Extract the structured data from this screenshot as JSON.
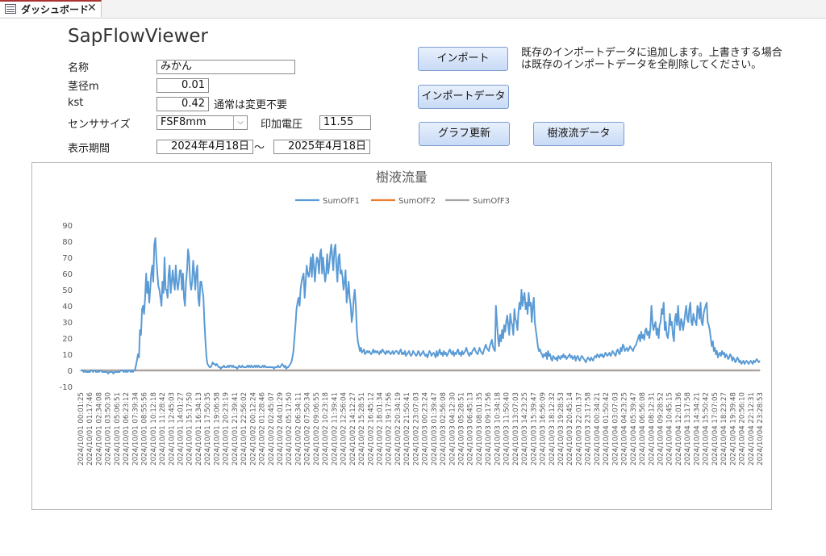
{
  "tab": {
    "label": "ダッシュボード",
    "close": "✕",
    "icon": "form-icon"
  },
  "app_title": "SapFlowViewer",
  "form": {
    "name_label": "名称",
    "name_value": "みかん",
    "stem_label": "茎径m",
    "stem_value": "0.01",
    "kst_label": "kst",
    "kst_value": "0.42",
    "kst_note": "通常は変更不要",
    "sensor_label": "センササイズ",
    "sensor_value": "FSF8mm",
    "sensor_arrow": "⌵",
    "voltage_label": "印加電圧",
    "voltage_value": "11.55",
    "period_label": "表示期間",
    "period_from": "2024年4月18日",
    "period_sep": "〜",
    "period_to": "2025年4月18日"
  },
  "buttons": {
    "import": "インポート",
    "import_data": "インポートデータ",
    "graph_update": "グラフ更新",
    "sapflow_data": "樹液流データ"
  },
  "import_note": "既存のインポートデータに追加します。上書きする場合は既存のインポートデータを全削除してください。",
  "colors": {
    "series1": "#5b9bd5",
    "series2": "#ed7d31",
    "series3": "#a5a5a5",
    "button_border": "#7e9ccf"
  },
  "chart_data": {
    "type": "line",
    "title": "樹液流量",
    "legend": [
      "SumOfF1",
      "SumOfF2",
      "SumOfF3"
    ],
    "legend_position": "top",
    "ylim": [
      -10,
      90
    ],
    "yticks": [
      -10,
      0,
      10,
      20,
      30,
      40,
      50,
      60,
      70,
      80,
      90
    ],
    "grid": false,
    "x_ticks": [
      "2024/10/01 00:01:25",
      "2024/10/01 01:17:46",
      "2024/10/01 02:34:08",
      "2024/10/01 03:50:30",
      "2024/10/01 05:06:51",
      "2024/10/01 06:23:12",
      "2024/10/01 07:39:34",
      "2024/10/01 08:55:56",
      "2024/10/01 10:12:18",
      "2024/10/01 11:28:42",
      "2024/10/01 12:45:03",
      "2024/10/01 14:01:27",
      "2024/10/01 15:17:50",
      "2024/10/01 16:34:13",
      "2024/10/01 17:50:35",
      "2024/10/01 19:06:58",
      "2024/10/01 20:23:19",
      "2024/10/01 21:39:41",
      "2024/10/01 22:56:02",
      "2024/10/02 00:12:24",
      "2024/10/02 01:28:46",
      "2024/10/02 02:45:07",
      "2024/10/02 04:01:29",
      "2024/10/02 05:17:50",
      "2024/10/02 06:34:11",
      "2024/10/02 07:50:34",
      "2024/10/02 09:06:55",
      "2024/10/02 10:23:18",
      "2024/10/02 11:39:41",
      "2024/10/02 12:56:04",
      "2024/10/02 14:12:27",
      "2024/10/02 15:28:51",
      "2024/10/02 16:45:12",
      "2024/10/02 18:01:34",
      "2024/10/02 19:17:56",
      "2024/10/02 20:34:19",
      "2024/10/02 21:50:41",
      "2024/10/02 23:07:03",
      "2024/10/03 00:23:24",
      "2024/10/03 01:39:47",
      "2024/10/03 02:56:08",
      "2024/10/03 04:12:30",
      "2024/10/03 05:28:51",
      "2024/10/03 06:45:13",
      "2024/10/03 08:01:35",
      "2024/10/03 09:17:56",
      "2024/10/03 10:34:18",
      "2024/10/03 11:50:40",
      "2024/10/03 13:07:03",
      "2024/10/03 14:23:25",
      "2024/10/03 15:39:47",
      "2024/10/03 16:56:09",
      "2024/10/03 18:12:32",
      "2024/10/03 19:28:53",
      "2024/10/03 20:45:14",
      "2024/10/03 22:01:37",
      "2024/10/03 23:17:58",
      "2024/10/04 00:34:21",
      "2024/10/04 01:50:42",
      "2024/10/04 03:07:03",
      "2024/10/04 04:23:25",
      "2024/10/04 05:39:47",
      "2024/10/04 06:56:08",
      "2024/10/04 08:12:31",
      "2024/10/04 09:28:52",
      "2024/10/04 10:45:15",
      "2024/10/04 12:01:36",
      "2024/10/04 13:17:58",
      "2024/10/04 14:34:21",
      "2024/10/04 15:50:42",
      "2024/10/04 17:07:05",
      "2024/10/04 18:23:27",
      "2024/10/04 19:39:48",
      "2024/10/04 20:56:10",
      "2024/10/04 22:12:31",
      "2024/10/04 23:28:53"
    ],
    "series": [
      {
        "name": "SumOfF1",
        "values": [
          0,
          0,
          0,
          -1,
          0,
          -1,
          -1,
          -1,
          -1,
          -1,
          0,
          0,
          -1,
          0,
          0,
          -1,
          -1,
          0,
          -1,
          0,
          0,
          -1,
          -1,
          -1,
          -1,
          -1,
          -1,
          -2,
          -1,
          -1,
          -1,
          -1,
          -2,
          -1,
          -1,
          -1,
          -1,
          -1,
          -1,
          0,
          0,
          0,
          -1,
          0,
          -1,
          0,
          -1,
          0,
          0,
          -1,
          0,
          -1,
          0,
          0,
          3,
          6,
          10,
          8,
          25,
          22,
          38,
          40,
          35,
          45,
          60,
          48,
          55,
          42,
          50,
          60,
          65,
          55,
          78,
          82,
          70,
          60,
          52,
          50,
          45,
          40,
          55,
          48,
          70,
          50,
          50,
          45,
          60,
          65,
          48,
          55,
          62,
          55,
          50,
          65,
          55,
          50,
          55,
          62,
          62,
          50,
          60,
          45,
          40,
          55,
          62,
          75,
          70,
          55,
          50,
          55,
          68,
          60,
          50,
          60,
          65,
          45,
          40,
          55,
          55,
          50,
          45,
          30,
          18,
          8,
          4,
          3,
          2,
          2,
          3,
          5,
          4,
          4,
          3,
          4,
          3,
          2,
          2,
          1,
          2,
          2,
          3,
          2,
          2,
          2,
          3,
          2,
          3,
          3,
          2,
          3,
          2,
          2,
          2,
          1,
          2,
          3,
          2,
          2,
          3,
          2,
          2,
          2,
          2,
          3,
          2,
          3,
          2,
          3,
          2,
          2,
          3,
          2,
          3,
          2,
          3,
          2,
          2,
          2,
          3,
          2,
          3,
          2,
          2,
          2,
          2,
          2,
          2,
          2,
          2,
          1,
          2,
          2,
          2,
          3,
          2,
          2,
          3,
          4,
          3,
          2,
          3,
          1,
          2,
          2,
          3,
          4,
          5,
          8,
          12,
          20,
          28,
          38,
          42,
          45,
          40,
          50,
          55,
          58,
          60,
          45,
          55,
          65,
          60,
          58,
          62,
          70,
          58,
          72,
          65,
          55,
          65,
          70,
          68,
          60,
          72,
          75,
          60,
          70,
          62,
          55,
          60,
          72,
          60,
          65,
          72,
          78,
          70,
          62,
          75,
          78,
          65,
          55,
          70,
          72,
          60,
          62,
          58,
          50,
          55,
          62,
          42,
          48,
          55,
          45,
          40,
          30,
          35,
          45,
          50,
          40,
          25,
          18,
          15,
          12,
          14,
          11,
          12,
          13,
          10,
          11,
          12,
          11,
          12,
          11,
          10,
          11,
          13,
          11,
          12,
          11,
          12,
          11,
          10,
          12,
          11,
          13,
          12,
          11,
          10,
          12,
          11,
          12,
          11,
          10,
          11,
          12,
          10,
          11,
          12,
          12,
          11,
          10,
          12,
          13,
          10,
          11,
          10,
          12,
          9,
          10,
          11,
          12,
          10,
          9,
          10,
          12,
          11,
          10,
          9,
          10,
          12,
          11,
          9,
          10,
          11,
          12,
          10,
          9,
          10,
          8,
          10,
          12,
          11,
          9,
          10,
          11,
          10,
          8,
          12,
          9,
          11,
          13,
          10,
          11,
          9,
          12,
          10,
          11,
          9,
          10,
          12,
          13,
          11,
          10,
          12,
          9,
          11,
          10,
          12,
          13,
          10,
          11,
          9,
          12,
          10,
          11,
          12,
          14,
          12,
          10,
          9,
          11,
          10,
          12,
          13,
          14,
          12,
          11,
          10,
          12,
          14,
          12,
          11,
          10,
          12,
          14,
          16,
          14,
          13,
          12,
          15,
          17,
          19,
          15,
          13,
          12,
          40,
          30,
          20,
          15,
          22,
          18,
          25,
          20,
          28,
          24,
          30,
          34,
          28,
          22,
          35,
          30,
          28,
          22,
          38,
          32,
          30,
          25,
          36,
          42,
          38,
          50,
          40,
          45,
          48,
          38,
          42,
          35,
          48,
          40,
          42,
          30,
          40,
          45,
          30,
          25,
          20,
          15,
          12,
          13,
          11,
          10,
          8,
          10,
          9,
          11,
          7,
          12,
          9,
          10,
          7,
          6,
          9,
          8,
          7,
          8,
          6,
          9,
          8,
          7,
          9,
          8,
          10,
          8,
          9,
          7,
          8,
          9,
          10,
          8,
          9,
          7,
          8,
          9,
          6,
          8,
          9,
          7,
          6,
          8,
          9,
          8,
          7,
          6,
          5,
          7,
          8,
          7,
          6,
          8,
          7,
          6,
          8,
          9,
          8,
          10,
          9,
          8,
          10,
          9,
          10,
          8,
          9,
          11,
          10,
          9,
          10,
          11,
          9,
          10,
          12,
          11,
          10,
          9,
          12,
          13,
          11,
          10,
          14,
          12,
          16,
          15,
          12,
          13,
          14,
          12,
          13,
          15,
          14,
          13,
          12,
          14,
          15,
          16,
          18,
          20,
          22,
          18,
          24,
          20,
          22,
          19,
          25,
          26,
          22,
          24,
          20,
          26,
          40,
          30,
          25,
          28,
          30,
          22,
          26,
          20,
          28,
          30,
          38,
          35,
          42,
          25,
          30,
          22,
          20,
          25,
          35,
          28,
          30,
          22,
          18,
          32,
          35,
          28,
          40,
          30,
          25,
          32,
          30,
          25,
          30,
          35,
          40,
          32,
          30,
          38,
          42,
          30,
          28,
          35,
          32,
          30,
          28,
          40,
          38,
          32,
          42,
          30,
          28,
          35,
          38,
          40,
          42,
          30,
          28,
          25,
          20,
          15,
          18,
          12,
          14,
          10,
          12,
          8,
          10,
          11,
          9,
          12,
          10,
          11,
          8,
          10,
          9,
          7,
          8,
          10,
          9,
          6,
          8,
          7,
          5,
          6,
          8,
          7,
          5,
          6,
          4,
          5,
          6,
          4,
          5,
          6,
          5,
          4,
          5,
          6,
          5,
          4,
          6,
          5,
          6,
          7,
          6,
          5,
          6
        ]
      },
      {
        "name": "SumOfF2",
        "values": [
          0,
          0
        ]
      },
      {
        "name": "SumOfF3",
        "values": [
          0,
          0
        ]
      }
    ]
  }
}
